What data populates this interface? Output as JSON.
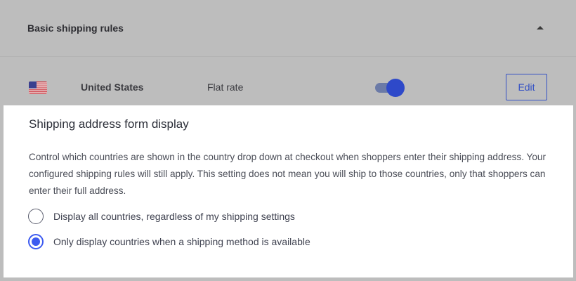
{
  "rules_section": {
    "title": "Basic shipping rules",
    "row": {
      "flag_icon": "us-flag-icon",
      "country": "United States",
      "method": "Flat rate",
      "enabled": true,
      "edit_label": "Edit"
    }
  },
  "form_display": {
    "title": "Shipping address form display",
    "description": "Control which countries are shown in the country drop down at checkout when shoppers enter their shipping address. Your configured shipping rules will still apply. This setting does not mean you will ship to those countries, only that shoppers can enter their full address.",
    "options": [
      {
        "label": "Display all countries, regardless of my shipping settings",
        "selected": false
      },
      {
        "label": "Only display countries when a shipping method is available",
        "selected": true
      }
    ]
  },
  "colors": {
    "accent": "#3d5bf0",
    "toggle_on": "#2e49c9",
    "backdrop": "#bdbdbd"
  }
}
